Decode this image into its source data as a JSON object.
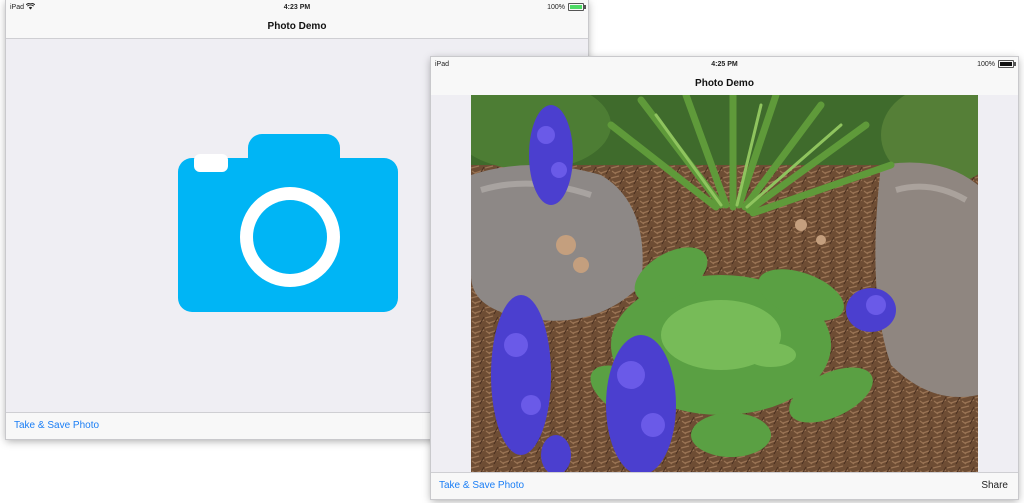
{
  "screens": [
    {
      "status": {
        "carrier": "iPad",
        "time": "4:23 PM",
        "battery": "100%",
        "battery_level": 1.0
      },
      "nav": {
        "title": "Photo Demo"
      },
      "toolbar": {
        "left_button": "Take & Save Photo"
      },
      "content": {
        "icon": "camera-icon"
      }
    },
    {
      "status": {
        "carrier": "iPad",
        "time": "4:25 PM",
        "battery": "100%",
        "battery_level": 1.0
      },
      "nav": {
        "title": "Photo Demo"
      },
      "toolbar": {
        "left_button": "Take & Save Photo",
        "right_button": "Share"
      },
      "content": {
        "image": "flower-photo"
      }
    }
  ],
  "colors": {
    "accent": "#1a7ef5",
    "camera": "#00b5f5",
    "battery_green": "#4cd964"
  }
}
